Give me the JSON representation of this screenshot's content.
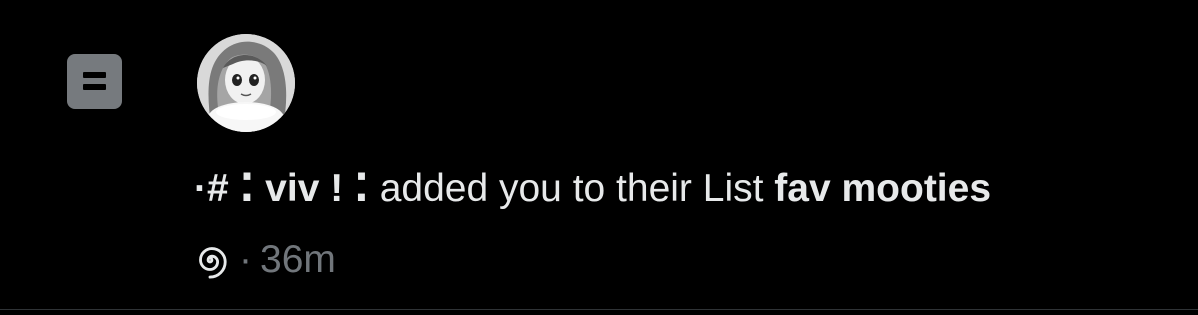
{
  "notification": {
    "type_icon": "list-icon",
    "avatar_icon": "avatar-illustration-icon",
    "user_display_name": "·# ⁚ viv ! ⁚",
    "action_text": " added you to their List ",
    "list_name": "fav mooties",
    "meta_icon": "spiral-icon",
    "separator": "·",
    "time_ago": "36m"
  },
  "colors": {
    "background": "#000000",
    "primary_text": "#e7e9ea",
    "secondary_text": "#71767b",
    "list_icon_bg": "#767a7e"
  }
}
